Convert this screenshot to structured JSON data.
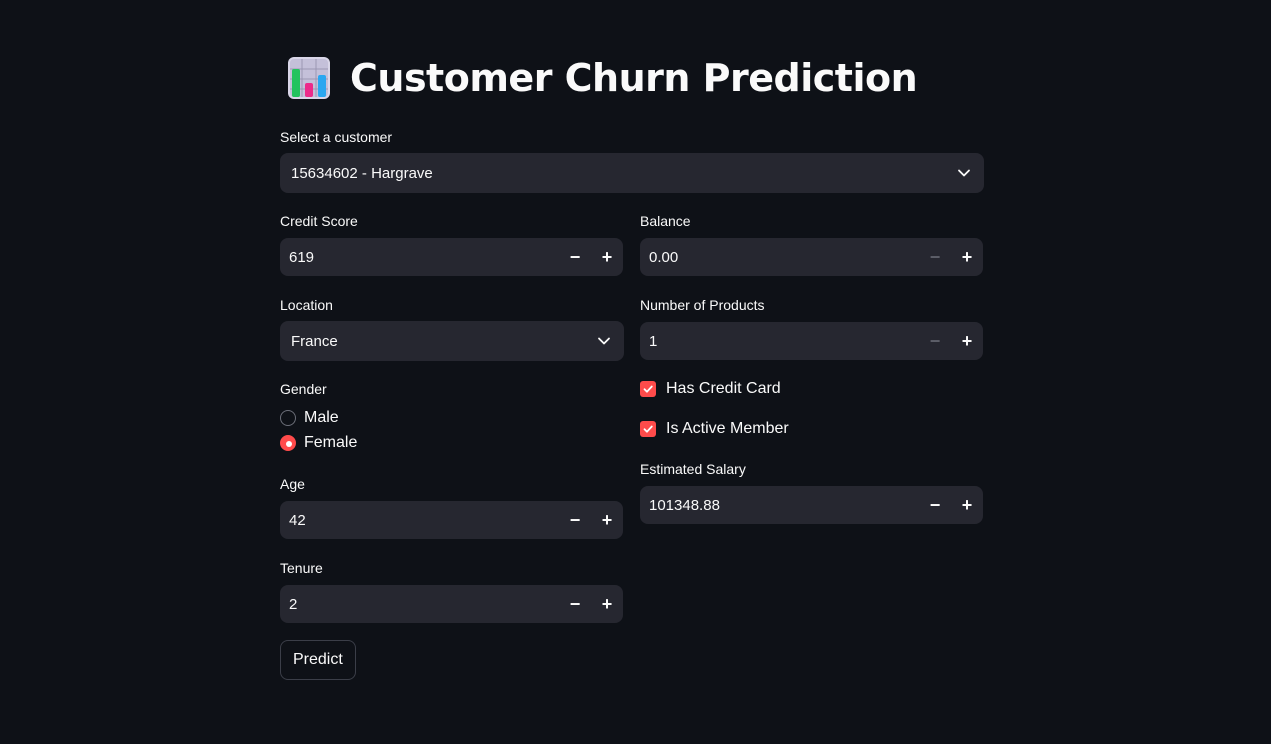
{
  "header": {
    "title": "Customer Churn Prediction",
    "icon": "bar-chart-emoji-icon"
  },
  "customer_select": {
    "label": "Select a customer",
    "value": "15634602 - Hargrave"
  },
  "credit_score": {
    "label": "Credit Score",
    "value": "619"
  },
  "balance": {
    "label": "Balance",
    "value": "0.00"
  },
  "location": {
    "label": "Location",
    "value": "France"
  },
  "num_products": {
    "label": "Number of Products",
    "value": "1"
  },
  "gender": {
    "label": "Gender",
    "options": [
      "Male",
      "Female"
    ],
    "selected": "Female"
  },
  "has_credit_card": {
    "label": "Has Credit Card",
    "checked": true
  },
  "is_active_member": {
    "label": "Is Active Member",
    "checked": true
  },
  "age": {
    "label": "Age",
    "value": "42"
  },
  "estimated_salary": {
    "label": "Estimated Salary",
    "value": "101348.88"
  },
  "tenure": {
    "label": "Tenure",
    "value": "2"
  },
  "predict_button": {
    "label": "Predict"
  },
  "stepper": {
    "minus": "−",
    "plus": "+"
  },
  "colors": {
    "background": "#0e1117",
    "input_bg": "#262730",
    "accent": "#ff4b4b",
    "text": "#fafafa"
  }
}
